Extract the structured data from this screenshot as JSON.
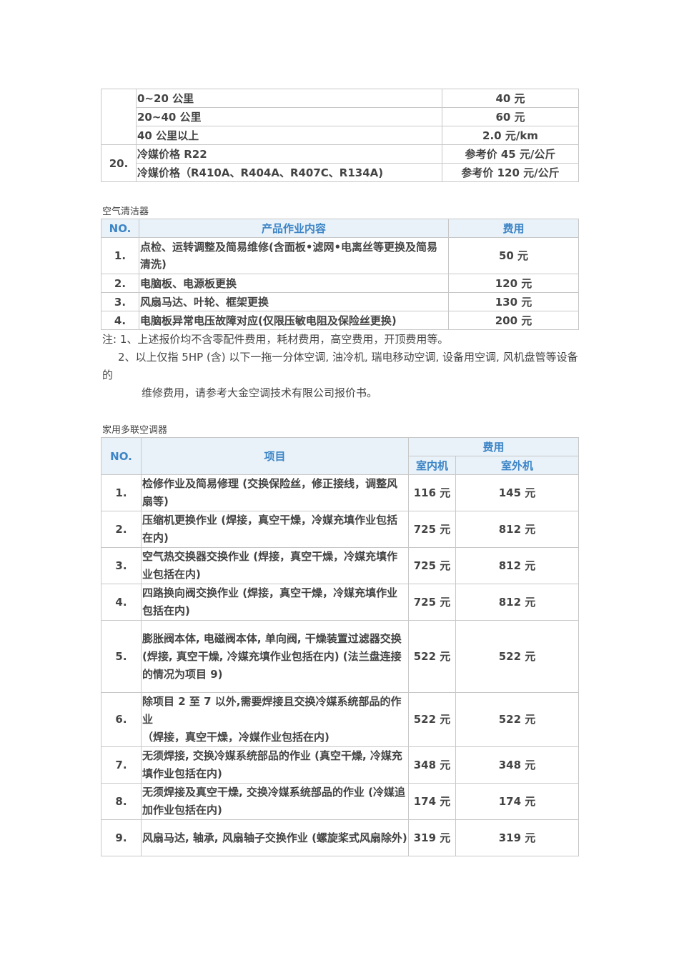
{
  "table1": {
    "rows": [
      {
        "item": "0~20 公里",
        "price": "40 元"
      },
      {
        "item": "20~40 公里",
        "price": "60 元"
      },
      {
        "item": "40 公里以上",
        "price": "2.0 元/km"
      }
    ],
    "row20_no": "20.",
    "row20": [
      {
        "item": "冷媒价格 R22",
        "price": "参考价 45 元/公斤"
      },
      {
        "item": "冷媒价格（R410A、R404A、R407C、R134A)",
        "price": "参考价 120 元/公斤"
      }
    ]
  },
  "section2": {
    "caption": "空气清洁器",
    "headers": {
      "no": "NO.",
      "content": "产品作业内容",
      "fee": "费用"
    },
    "rows": [
      {
        "no": "1.",
        "content": "点检、运转调整及简易维修(含面板•滤网•电离丝等更换及简易清洗)",
        "fee": "50 元"
      },
      {
        "no": "2.",
        "content": "电脑板、电源板更换",
        "fee": "120 元"
      },
      {
        "no": "3.",
        "content": "风扇马达、叶轮、框架更换",
        "fee": "130 元"
      },
      {
        "no": "4.",
        "content": "电脑板异常电压故障对应(仅限压敏电阻及保险丝更换)",
        "fee": "200 元"
      }
    ]
  },
  "notes": {
    "line1": "注: 1、上述报价均不含零配件费用，耗材费用，高空费用，开顶费用等。",
    "line2": "2、以上仅指 5HP (含) 以下一拖一分体空调, 油冷机, 瑞电移动空调, 设备用空调, 风机盘管等设备的",
    "line3": "维修费用，请参考大金空调技术有限公司报价书。"
  },
  "section3": {
    "caption": "家用多联空调器",
    "headers": {
      "no": "NO.",
      "item": "项目",
      "fee": "费用",
      "indoor": "室内机",
      "outdoor": "室外机"
    },
    "rows": [
      {
        "no": "1.",
        "item": "检修作业及简易修理 (交换保险丝，修正接线，调整风扇等)",
        "indoor": "116 元",
        "outdoor": "145 元"
      },
      {
        "no": "2.",
        "item": "压缩机更换作业 (焊接，真空干燥，冷媒充填作业包括在内)",
        "indoor": "725 元",
        "outdoor": "812 元"
      },
      {
        "no": "3.",
        "item": "空气热交换器交换作业 (焊接，真空干燥，冷媒充填作业包括在内)",
        "indoor": "725 元",
        "outdoor": "812 元"
      },
      {
        "no": "4.",
        "item": "四路换向阀交换作业 (焊接，真空干燥，冷媒充填作业包括在内)",
        "indoor": "725 元",
        "outdoor": "812 元"
      },
      {
        "no": "5.",
        "item": "膨胀阀本体, 电磁阀本体, 单向阀, 干燥装置过滤器交换",
        "item2": "(焊接, 真空干燥, 冷媒充填作业包括在内) (法兰盘连接的情况为项目 9)",
        "indoor": "522 元",
        "outdoor": "522 元"
      },
      {
        "no": "6.",
        "item": "除项目 2 至 7 以外,需要焊接且交换冷媒系统部品的作业",
        "item2": "（焊接，真空干燥，冷媒作业包括在内)",
        "indoor": "522 元",
        "outdoor": "522 元"
      },
      {
        "no": "7.",
        "item": "无须焊接, 交换冷媒系统部品的作业 (真空干燥, 冷媒充填作业包括在内)",
        "indoor": "348 元",
        "outdoor": "348 元"
      },
      {
        "no": "8.",
        "item": "无须焊接及真空干燥, 交换冷媒系统部品的作业 (冷媒追加作业包括在内)",
        "indoor": "174 元",
        "outdoor": "174 元"
      },
      {
        "no": "9.",
        "item": "风扇马达, 轴承, 风扇轴子交换作业 (螺旋桨式风扇除外)",
        "indoor": "319 元",
        "outdoor": "319 元"
      }
    ]
  }
}
